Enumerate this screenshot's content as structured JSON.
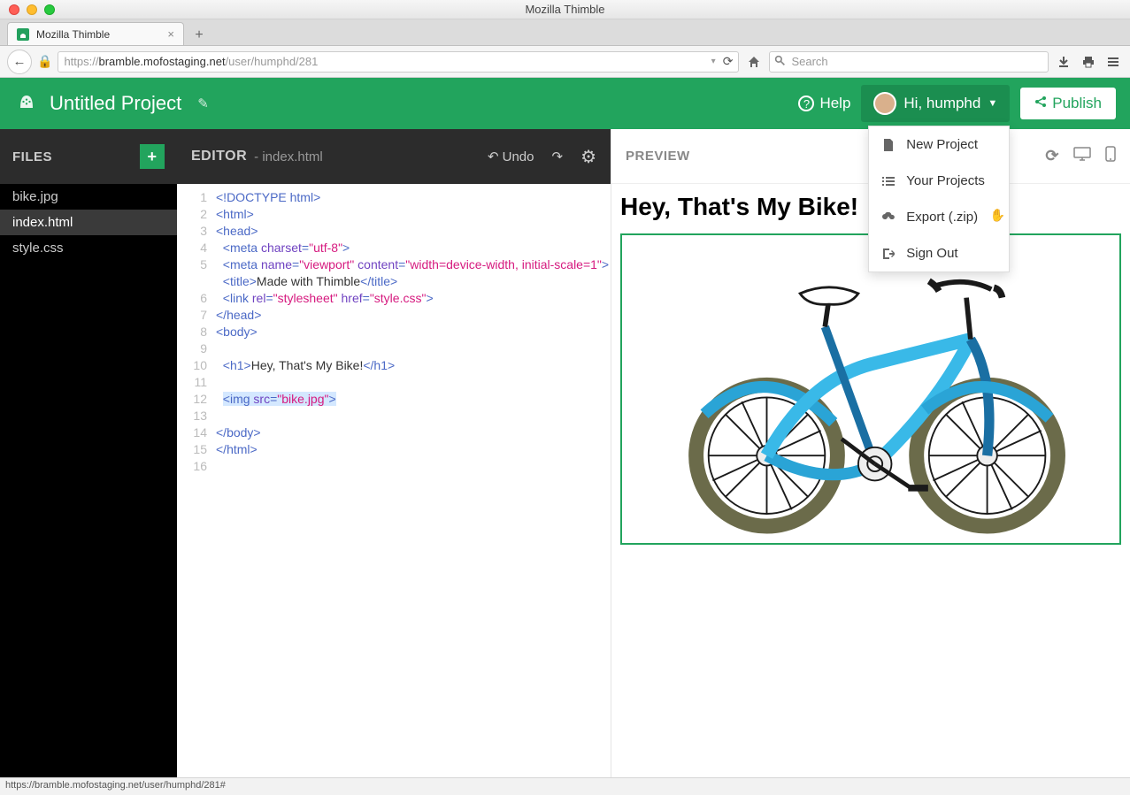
{
  "window": {
    "title": "Mozilla Thimble",
    "tab_title": "Mozilla Thimble",
    "url_prefix": "https://",
    "url_host": "bramble.mofostaging.net",
    "url_path": "/user/humphd/281",
    "search_placeholder": "Search",
    "status_url": "https://bramble.mofostaging.net/user/humphd/281#"
  },
  "thimble": {
    "project_title": "Untitled Project",
    "help_label": "Help",
    "user_greeting": "Hi, humphd",
    "publish_label": "Publish",
    "user_menu": {
      "new_project": "New Project",
      "your_projects": "Your Projects",
      "export": "Export (.zip)",
      "sign_out": "Sign Out"
    }
  },
  "files": {
    "header": "FILES",
    "items": [
      "bike.jpg",
      "index.html",
      "style.css"
    ],
    "active_index": 1
  },
  "editor": {
    "header": "EDITOR",
    "filename": "index.html",
    "undo_label": "Undo",
    "line_numbers": [
      "1",
      "2",
      "3",
      "4",
      "5",
      "6",
      "7",
      "8",
      "9",
      "10",
      "11",
      "12",
      "13",
      "14",
      "15",
      "16"
    ]
  },
  "code": {
    "l1_doctype": "<!DOCTYPE html>",
    "l2": "<html>",
    "l3": "<head>",
    "l4_tag": "meta",
    "l4_attr": "charset",
    "l4_val": "\"utf-8\"",
    "l5_tag": "meta",
    "l5_attr1": "name",
    "l5_val1": "\"viewport\"",
    "l5_attr2": "content",
    "l5_val2": "\"width=device-width, initial-scale=1\"",
    "l6_open": "<title>",
    "l6_txt": "Made with Thimble",
    "l6_close": "</title>",
    "l7_tag": "link",
    "l7_attr1": "rel",
    "l7_val1": "\"stylesheet\"",
    "l7_attr2": "href",
    "l7_val2": "\"style.css\"",
    "l8": "</head>",
    "l9": "<body>",
    "l11_open": "<h1>",
    "l11_txt": "Hey, That's My Bike!",
    "l11_close": "</h1>",
    "l13_tag": "img",
    "l13_attr": "src",
    "l13_val": "\"bike.jpg\"",
    "l15": "</body>",
    "l16": "</html>"
  },
  "preview": {
    "header": "PREVIEW",
    "heading": "Hey, That's My Bike!"
  }
}
